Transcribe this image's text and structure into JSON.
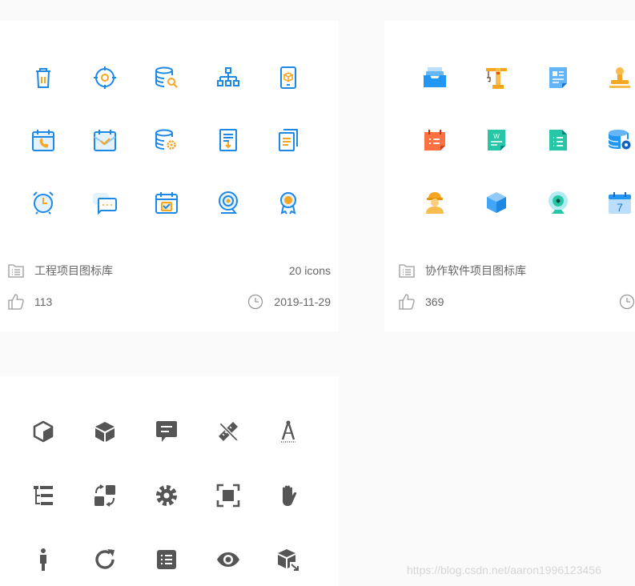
{
  "cards": [
    {
      "name": "工程项目图标库",
      "icon_count": "20 icons",
      "likes": "113",
      "date": "2019-11-29",
      "accent_color": "#1e88e5",
      "secondary_color": "#f5a623",
      "icons": [
        "trash-can-icon",
        "target-gear-icon",
        "database-search-icon",
        "org-chart-icon",
        "tablet-cube-icon",
        "calendar-phone-icon",
        "calendar-check-icon",
        "database-gear-icon",
        "document-download-icon",
        "documents-copy-icon",
        "alarm-clock-icon",
        "chat-bubbles-icon",
        "calendar-checkbox-icon",
        "webcam-icon",
        "award-medal-icon"
      ]
    },
    {
      "name": "协作软件项目图标库",
      "likes": "369",
      "icons": [
        "inbox-tray-icon",
        "tower-crane-icon",
        "document-page-icon",
        "stamp-icon",
        "calendar-list-icon",
        "word-file-icon",
        "list-file-icon",
        "database-settings-icon",
        "construction-worker-icon",
        "cube-3d-icon",
        "webcam-icon",
        "calendar-7-icon"
      ],
      "calendar_day": "7",
      "word_letter": "W"
    },
    {
      "icons": [
        "cube-outline-icon",
        "cube-solid-icon",
        "message-box-icon",
        "pencil-ruler-icon",
        "compass-drawing-icon",
        "tree-list-icon",
        "swap-squares-icon",
        "gear-icon",
        "focus-frame-icon",
        "hand-stop-icon",
        "person-icon",
        "refresh-icon",
        "list-box-icon",
        "eye-icon",
        "box-export-icon"
      ],
      "icon_color": "#555555"
    }
  ],
  "watermark": "https://blog.csdn.net/aaron1996123456"
}
